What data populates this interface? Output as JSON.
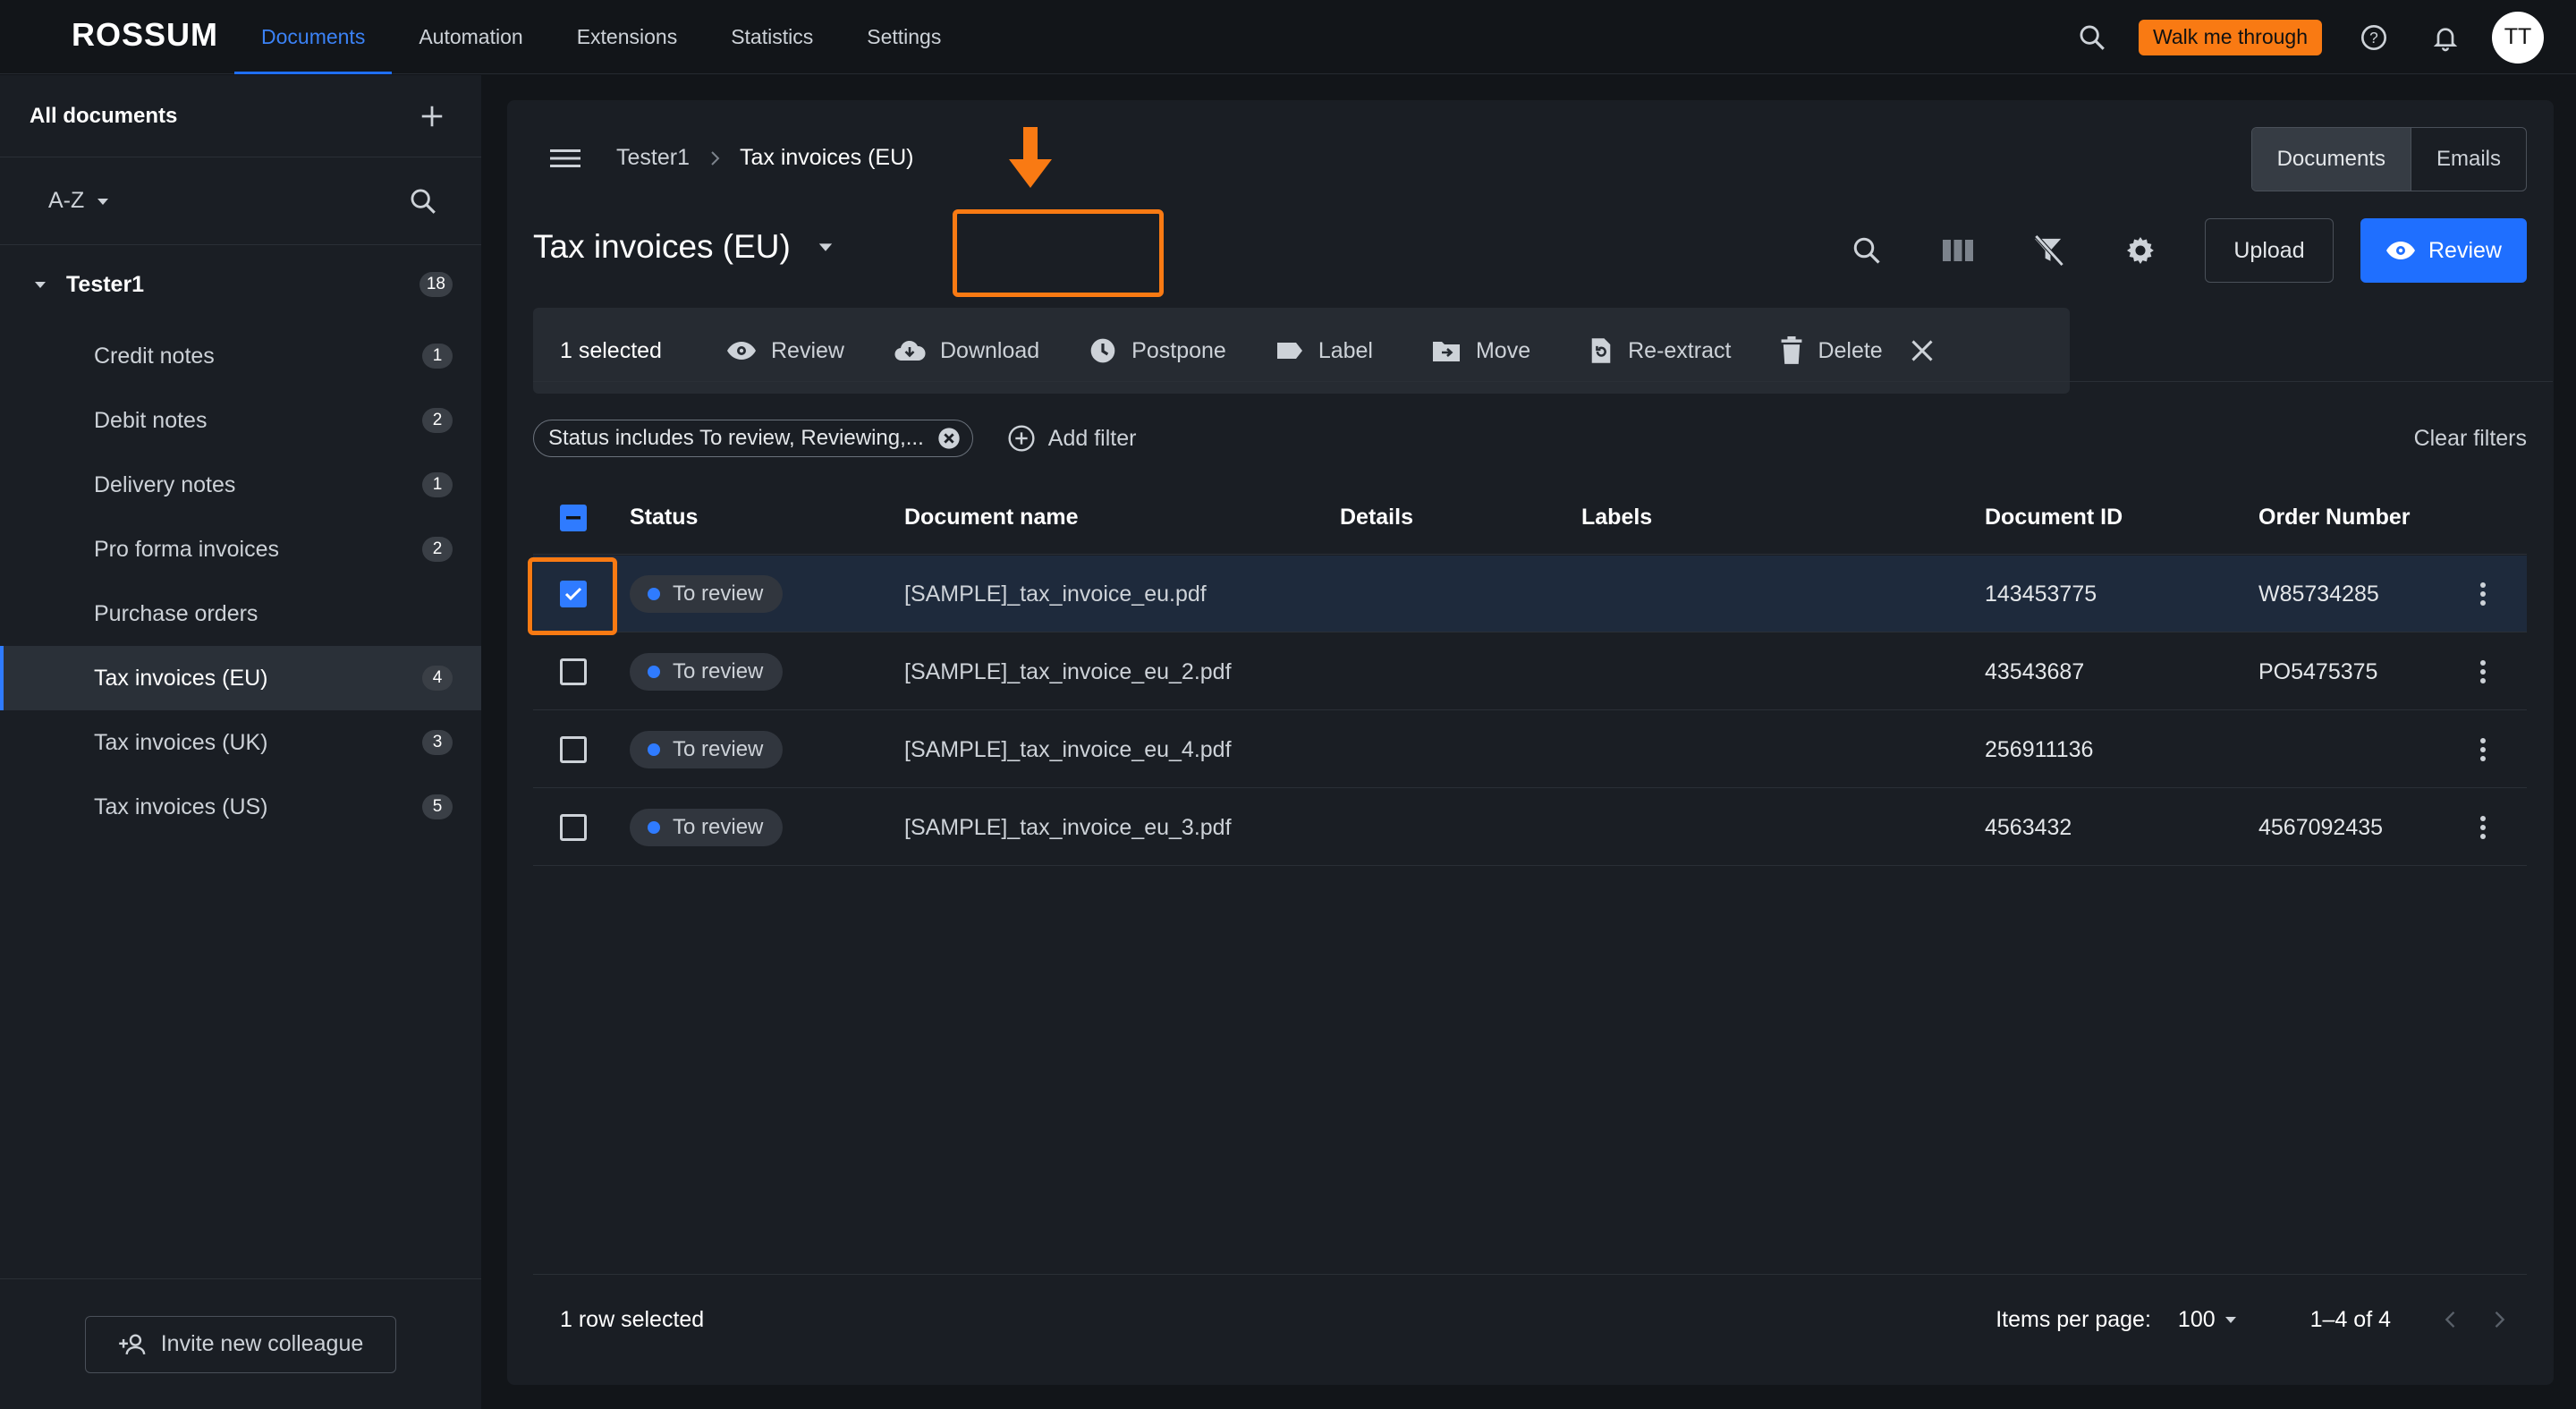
{
  "app": {
    "logo_text": "ROSSUM",
    "nav_tabs": [
      "Documents",
      "Automation",
      "Extensions",
      "Statistics",
      "Settings"
    ],
    "active_tab": "Documents",
    "walk_me_label": "Walk me through",
    "avatar_initials": "TT"
  },
  "sidebar": {
    "title": "All documents",
    "sort_label": "A-Z",
    "group": {
      "name": "Tester1",
      "count": "18"
    },
    "items": [
      {
        "label": "Credit notes",
        "count": "1"
      },
      {
        "label": "Debit notes",
        "count": "2"
      },
      {
        "label": "Delivery notes",
        "count": "1"
      },
      {
        "label": "Pro forma invoices",
        "count": "2"
      },
      {
        "label": "Purchase orders",
        "count": ""
      },
      {
        "label": "Tax invoices (EU)",
        "count": "4"
      },
      {
        "label": "Tax invoices (UK)",
        "count": "3"
      },
      {
        "label": "Tax invoices (US)",
        "count": "5"
      }
    ],
    "invite_label": "Invite new colleague"
  },
  "main": {
    "breadcrumb": [
      "Tester1",
      "Tax invoices (EU)"
    ],
    "segment": {
      "documents": "Documents",
      "emails": "Emails"
    },
    "queue_title": "Tax invoices (EU)",
    "upload_label": "Upload",
    "review_label": "Review",
    "actionbar": {
      "selected_text": "1 selected",
      "review": "Review",
      "download": "Download",
      "postpone": "Postpone",
      "label": "Label",
      "move": "Move",
      "reextract": "Re-extract",
      "delete": "Delete"
    },
    "filter_chip": "Status includes To review, Reviewing,...",
    "add_filter": "Add filter",
    "clear_filters": "Clear filters",
    "columns": [
      "Status",
      "Document name",
      "Details",
      "Labels",
      "Document ID",
      "Order Number"
    ],
    "rows": [
      {
        "status": "To review",
        "name": "[SAMPLE]_tax_invoice_eu.pdf",
        "details": "",
        "labels": "",
        "doc_id": "143453775",
        "order": "W85734285",
        "checked": true
      },
      {
        "status": "To review",
        "name": "[SAMPLE]_tax_invoice_eu_2.pdf",
        "details": "",
        "labels": "",
        "doc_id": "43543687",
        "order": "PO5475375",
        "checked": false
      },
      {
        "status": "To review",
        "name": "[SAMPLE]_tax_invoice_eu_4.pdf",
        "details": "",
        "labels": "",
        "doc_id": "256911136",
        "order": "",
        "checked": false
      },
      {
        "status": "To review",
        "name": "[SAMPLE]_tax_invoice_eu_3.pdf",
        "details": "",
        "labels": "",
        "doc_id": "4563432",
        "order": "4567092435",
        "checked": false
      }
    ],
    "footer": {
      "rows_selected": "1 row selected",
      "items_per_page_label": "Items per page:",
      "items_per_page": "100",
      "range": "1–4 of 4"
    }
  },
  "colors": {
    "accent": "#1f6fff",
    "highlight": "#f97a13",
    "background": "#121519",
    "panel": "#1a1e24"
  }
}
